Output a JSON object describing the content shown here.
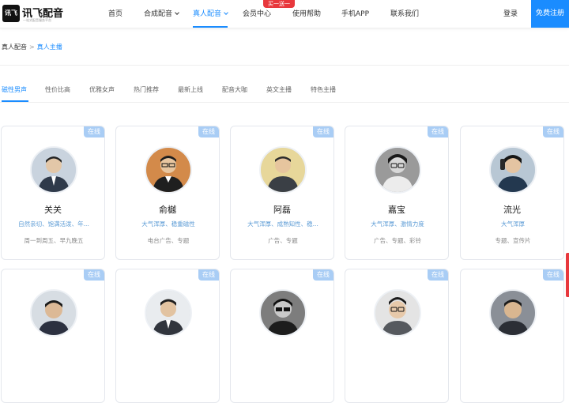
{
  "logo": {
    "mark": "讯飞",
    "name": "讯飞配音",
    "tagline": "一站式配音服务平台"
  },
  "nav": {
    "items": [
      {
        "label": "首页"
      },
      {
        "label": "合成配音"
      },
      {
        "label": "真人配音"
      },
      {
        "label": "会员中心"
      },
      {
        "label": "使用帮助"
      },
      {
        "label": "手机APP"
      },
      {
        "label": "联系我们"
      }
    ],
    "badge": "买一送一",
    "login": "登录",
    "register": "免费注册"
  },
  "breadcrumb": {
    "root": "真人配音",
    "separator": ">",
    "current": "真人主播"
  },
  "tabs": [
    "磁性男声",
    "性价比高",
    "优雅女声",
    "热门推荐",
    "最新上线",
    "配音大咖",
    "英文主播",
    "特色主播"
  ],
  "cards": [
    {
      "status": "在线",
      "name": "关关",
      "tags": "自然亲切、饱满活泼、年...",
      "uses": "周一到周五、早九晚五"
    },
    {
      "status": "在线",
      "name": "俞樾",
      "tags": "大气浑厚、稳重磁性",
      "uses": "电台广告、专题"
    },
    {
      "status": "在线",
      "name": "阿磊",
      "tags": "大气浑厚、成熟知性、稳...",
      "uses": "广告、专题"
    },
    {
      "status": "在线",
      "name": "嘉宝",
      "tags": "大气浑厚、激情力度",
      "uses": "广告、专题、彩铃"
    },
    {
      "status": "在线",
      "name": "流光",
      "tags": "大气浑厚",
      "uses": "专题、宣传片"
    },
    {
      "status": "在线",
      "name": "",
      "tags": "",
      "uses": ""
    },
    {
      "status": "在线",
      "name": "",
      "tags": "",
      "uses": ""
    },
    {
      "status": "在线",
      "name": "",
      "tags": "",
      "uses": ""
    },
    {
      "status": "在线",
      "name": "",
      "tags": "",
      "uses": ""
    },
    {
      "status": "在线",
      "name": "",
      "tags": "",
      "uses": ""
    }
  ],
  "colors": {
    "accent": "#1a8cff",
    "badge": "#e8383d",
    "online": "#a9cdf5",
    "tag_text": "#5b9bd5"
  }
}
